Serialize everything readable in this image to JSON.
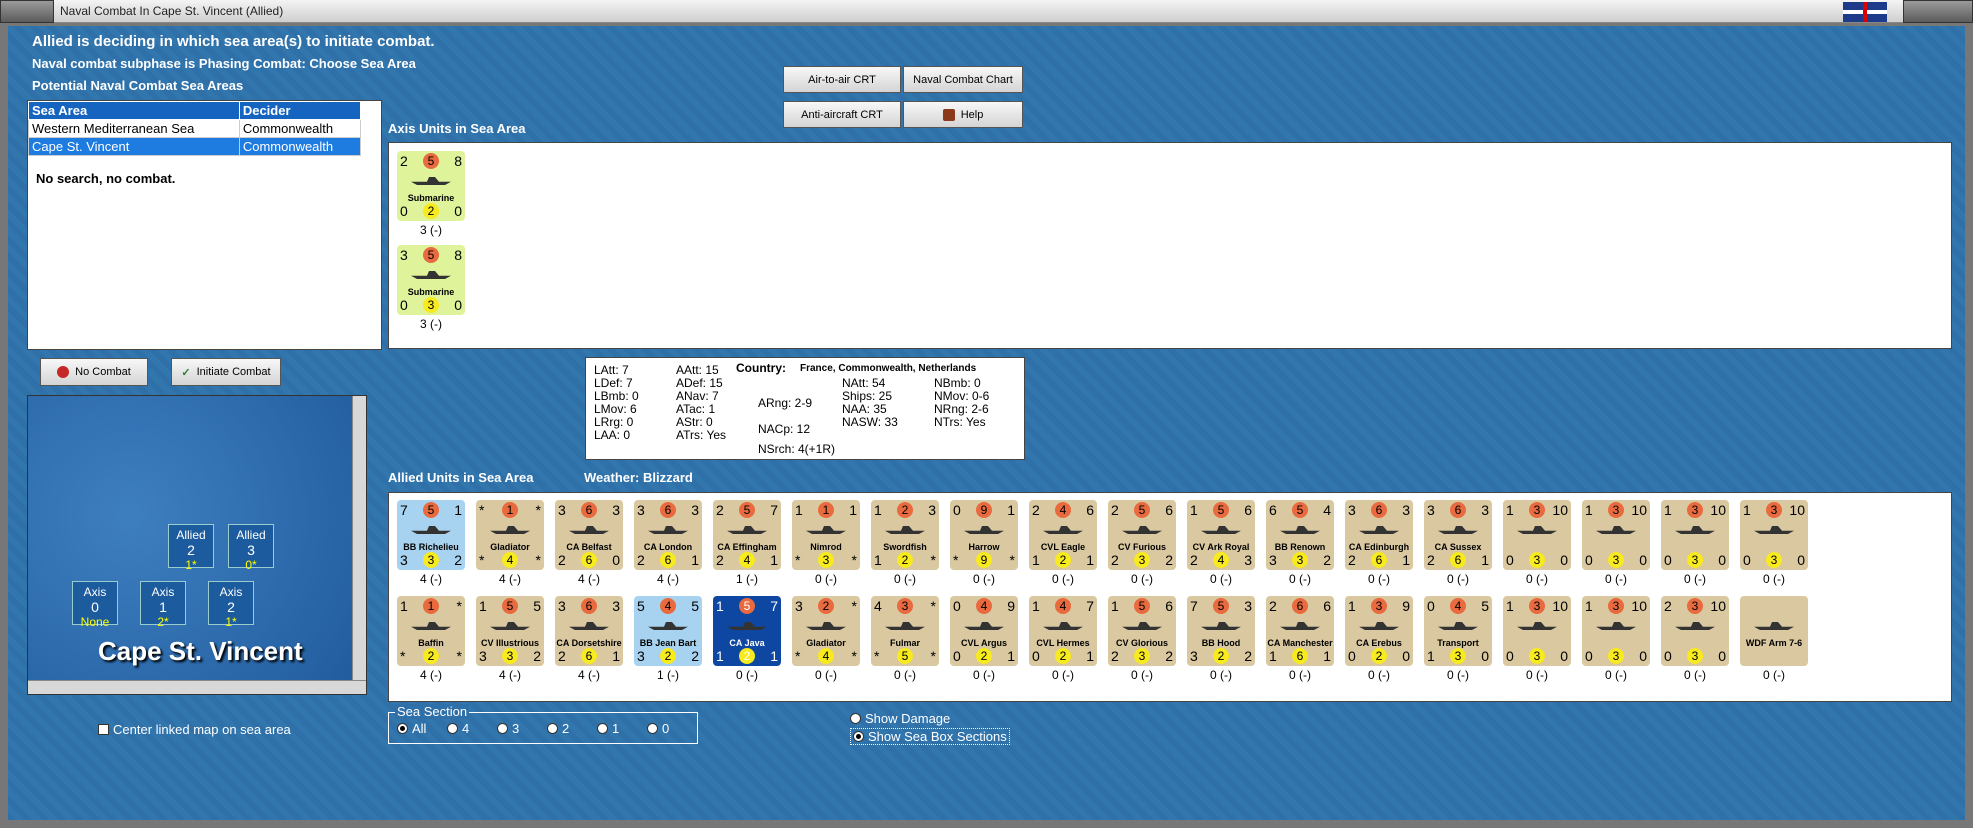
{
  "window": {
    "title": "Naval Combat In Cape St. Vincent (Allied)"
  },
  "headings": {
    "status": "Allied is deciding in which sea area(s) to initiate combat.",
    "subphase": "Naval combat subphase is Phasing Combat: Choose Sea Area",
    "potential": "Potential Naval Combat Sea Areas"
  },
  "sea_table": {
    "col_area": "Sea Area",
    "col_decider": "Decider",
    "rows": [
      {
        "area": "Western Mediterranean Sea",
        "decider": "Commonwealth"
      },
      {
        "area": "Cape St. Vincent",
        "decider": "Commonwealth"
      }
    ],
    "note": "No search, no combat."
  },
  "buttons": {
    "air_to_air": "Air-to-air CRT",
    "naval_chart": "Naval Combat Chart",
    "anti_aircraft": "Anti-aircraft CRT",
    "help": "Help",
    "no_combat": "No Combat",
    "initiate": "Initiate Combat"
  },
  "labels": {
    "axis_units": "Axis Units in Sea Area",
    "allied_units": "Allied Units in Sea Area",
    "weather": "Weather:  Blizzard"
  },
  "axis_units": [
    {
      "tl": "2",
      "tc": "5",
      "tr": "8",
      "name": "Submarine",
      "bl": "0",
      "bc": "2",
      "br": "0",
      "cap": "3 (-)"
    },
    {
      "tl": "3",
      "tc": "5",
      "tr": "8",
      "name": "Submarine",
      "bl": "0",
      "bc": "3",
      "br": "0",
      "cap": "3 (-)"
    }
  ],
  "stats": {
    "country_label": "Country:",
    "country_value": "France, Commonwealth, Netherlands",
    "col1": [
      "LAtt: 7",
      "LDef: 7",
      "LBmb: 0",
      "LMov: 6",
      "LRrg: 0",
      "LAA: 0"
    ],
    "col2": [
      "AAtt: 15",
      "ADef: 15",
      "ANav: 7",
      "ATac: 1",
      "AStr: 0",
      "ATrs: Yes"
    ],
    "col3": [
      "ARng: 2-9",
      "NACp: 12",
      "NSrch: 4(+1R)"
    ],
    "col4": [
      "NAtt: 54",
      "Ships: 25",
      "NAA: 35",
      "NASW: 33"
    ],
    "col5": [
      "NBmb: 0",
      "NMov: 0-6",
      "NRng: 2-6",
      "NTrs: Yes"
    ]
  },
  "allied_row1": [
    {
      "tl": "7",
      "tc": "5",
      "tr": "1",
      "name": "BB Richelieu",
      "bl": "3",
      "bc": "3",
      "br": "2",
      "cap": "4 (-)",
      "tone": "blue"
    },
    {
      "tl": "*",
      "tc": "1",
      "tr": "*",
      "name": "Gladiator",
      "bl": "*",
      "bc": "4",
      "br": "*",
      "cap": "4 (-)",
      "tone": "tan"
    },
    {
      "tl": "3",
      "tc": "6",
      "tr": "3",
      "name": "CA Belfast",
      "bl": "2",
      "bc": "6",
      "br": "0",
      "cap": "4 (-)",
      "tone": "tan"
    },
    {
      "tl": "3",
      "tc": "6",
      "tr": "3",
      "name": "CA London",
      "bl": "2",
      "bc": "6",
      "br": "1",
      "cap": "4 (-)",
      "tone": "tan"
    },
    {
      "tl": "2",
      "tc": "5",
      "tr": "7",
      "name": "CA Effingham",
      "bl": "2",
      "bc": "4",
      "br": "1",
      "cap": "1 (-)",
      "tone": "tan"
    },
    {
      "tl": "1",
      "tc": "1",
      "tr": "1",
      "name": "Nimrod",
      "bl": "*",
      "bc": "3",
      "br": "*",
      "cap": "0 (-)",
      "tone": "tan"
    },
    {
      "tl": "1",
      "tc": "2",
      "tr": "3",
      "name": "Swordfish",
      "bl": "1",
      "bc": "2",
      "br": "*",
      "cap": "0 (-)",
      "tone": "tan"
    },
    {
      "tl": "0",
      "tc": "9",
      "tr": "1",
      "name": "Harrow",
      "bl": "*",
      "bc": "9",
      "br": "*",
      "cap": "0 (-)",
      "tone": "tan"
    },
    {
      "tl": "2",
      "tc": "4",
      "tr": "6",
      "name": "CVL Eagle",
      "bl": "1",
      "bc": "2",
      "br": "1",
      "cap": "0 (-)",
      "tone": "tan"
    },
    {
      "tl": "2",
      "tc": "5",
      "tr": "6",
      "name": "CV Furious",
      "bl": "2",
      "bc": "3",
      "br": "2",
      "cap": "0 (-)",
      "tone": "tan"
    },
    {
      "tl": "1",
      "tc": "5",
      "tr": "6",
      "name": "CV Ark Royal",
      "bl": "2",
      "bc": "4",
      "br": "3",
      "cap": "0 (-)",
      "tone": "tan"
    },
    {
      "tl": "6",
      "tc": "5",
      "tr": "4",
      "name": "BB Renown",
      "bl": "3",
      "bc": "3",
      "br": "2",
      "cap": "0 (-)",
      "tone": "tan"
    },
    {
      "tl": "3",
      "tc": "6",
      "tr": "3",
      "name": "CA Edinburgh",
      "bl": "2",
      "bc": "6",
      "br": "1",
      "cap": "0 (-)",
      "tone": "tan"
    },
    {
      "tl": "3",
      "tc": "6",
      "tr": "3",
      "name": "CA Sussex",
      "bl": "2",
      "bc": "6",
      "br": "1",
      "cap": "0 (-)",
      "tone": "tan"
    },
    {
      "tl": "1",
      "tc": "3",
      "tr": "10",
      "name": "",
      "bl": "0",
      "bc": "3",
      "br": "0",
      "cap": "0 (-)",
      "tone": "tan"
    },
    {
      "tl": "1",
      "tc": "3",
      "tr": "10",
      "name": "",
      "bl": "0",
      "bc": "3",
      "br": "0",
      "cap": "0 (-)",
      "tone": "tan"
    },
    {
      "tl": "1",
      "tc": "3",
      "tr": "10",
      "name": "",
      "bl": "0",
      "bc": "3",
      "br": "0",
      "cap": "0 (-)",
      "tone": "tan"
    },
    {
      "tl": "1",
      "tc": "3",
      "tr": "10",
      "name": "",
      "bl": "0",
      "bc": "3",
      "br": "0",
      "cap": "0 (-)",
      "tone": "tan"
    }
  ],
  "allied_row2": [
    {
      "tl": "1",
      "tc": "1",
      "tr": "*",
      "name": "Baffin",
      "bl": "*",
      "bc": "2",
      "br": "*",
      "cap": "4 (-)",
      "tone": "tan"
    },
    {
      "tl": "1",
      "tc": "5",
      "tr": "5",
      "name": "CV Illustrious",
      "bl": "3",
      "bc": "3",
      "br": "2",
      "cap": "4 (-)",
      "tone": "tan"
    },
    {
      "tl": "3",
      "tc": "6",
      "tr": "3",
      "name": "CA Dorsetshire",
      "bl": "2",
      "bc": "6",
      "br": "1",
      "cap": "4 (-)",
      "tone": "tan"
    },
    {
      "tl": "5",
      "tc": "4",
      "tr": "5",
      "name": "BB Jean Bart",
      "bl": "3",
      "bc": "2",
      "br": "2",
      "cap": "1 (-)",
      "tone": "blue"
    },
    {
      "tl": "1",
      "tc": "5",
      "tr": "7",
      "name": "CA Java",
      "bl": "1",
      "bc": "2",
      "br": "1",
      "cap": "0 (-)",
      "tone": "dark"
    },
    {
      "tl": "3",
      "tc": "2",
      "tr": "*",
      "name": "Gladiator",
      "bl": "*",
      "bc": "4",
      "br": "*",
      "cap": "0 (-)",
      "tone": "tan"
    },
    {
      "tl": "4",
      "tc": "3",
      "tr": "*",
      "name": "Fulmar",
      "bl": "*",
      "bc": "5",
      "br": "*",
      "cap": "0 (-)",
      "tone": "tan"
    },
    {
      "tl": "0",
      "tc": "4",
      "tr": "9",
      "name": "CVL Argus",
      "bl": "0",
      "bc": "2",
      "br": "1",
      "cap": "0 (-)",
      "tone": "tan"
    },
    {
      "tl": "1",
      "tc": "4",
      "tr": "7",
      "name": "CVL Hermes",
      "bl": "0",
      "bc": "2",
      "br": "1",
      "cap": "0 (-)",
      "tone": "tan"
    },
    {
      "tl": "1",
      "tc": "5",
      "tr": "6",
      "name": "CV Glorious",
      "bl": "2",
      "bc": "3",
      "br": "2",
      "cap": "0 (-)",
      "tone": "tan"
    },
    {
      "tl": "7",
      "tc": "5",
      "tr": "3",
      "name": "BB Hood",
      "bl": "3",
      "bc": "2",
      "br": "2",
      "cap": "0 (-)",
      "tone": "tan"
    },
    {
      "tl": "2",
      "tc": "6",
      "tr": "6",
      "name": "CA Manchester",
      "bl": "1",
      "bc": "6",
      "br": "1",
      "cap": "0 (-)",
      "tone": "tan"
    },
    {
      "tl": "1",
      "tc": "3",
      "tr": "9",
      "name": "CA Erebus",
      "bl": "0",
      "bc": "2",
      "br": "0",
      "cap": "0 (-)",
      "tone": "tan"
    },
    {
      "tl": "0",
      "tc": "4",
      "tr": "5",
      "name": "Transport",
      "bl": "1",
      "bc": "3",
      "br": "0",
      "cap": "0 (-)",
      "tone": "tan"
    },
    {
      "tl": "1",
      "tc": "3",
      "tr": "10",
      "name": "",
      "bl": "0",
      "bc": "3",
      "br": "0",
      "cap": "0 (-)",
      "tone": "tan"
    },
    {
      "tl": "1",
      "tc": "3",
      "tr": "10",
      "name": "",
      "bl": "0",
      "bc": "3",
      "br": "0",
      "cap": "0 (-)",
      "tone": "tan"
    },
    {
      "tl": "2",
      "tc": "3",
      "tr": "10",
      "name": "",
      "bl": "0",
      "bc": "3",
      "br": "0",
      "cap": "0 (-)",
      "tone": "tan"
    },
    {
      "tl": "",
      "tc": "",
      "tr": "",
      "name": "WDF Arm 7-6",
      "bl": "",
      "bc": "",
      "br": "",
      "cap": "0 (-)",
      "tone": "tan"
    }
  ],
  "map": {
    "name": "Cape St. Vincent",
    "boxes": [
      {
        "title": "Allied",
        "value": "2",
        "sub": "1*"
      },
      {
        "title": "Allied",
        "value": "3",
        "sub": "0*"
      },
      {
        "title": "Axis",
        "value": "0",
        "sub": "None"
      },
      {
        "title": "Axis",
        "value": "1",
        "sub": "2*"
      },
      {
        "title": "Axis",
        "value": "2",
        "sub": "1*"
      }
    ],
    "center_linked": "Center linked map on sea area"
  },
  "sea_section": {
    "legend": "Sea Section",
    "options": [
      "All",
      "4",
      "3",
      "2",
      "1",
      "0"
    ],
    "selected": "All"
  },
  "view_options": {
    "damage": "Show Damage",
    "sections": "Show Sea Box Sections"
  }
}
